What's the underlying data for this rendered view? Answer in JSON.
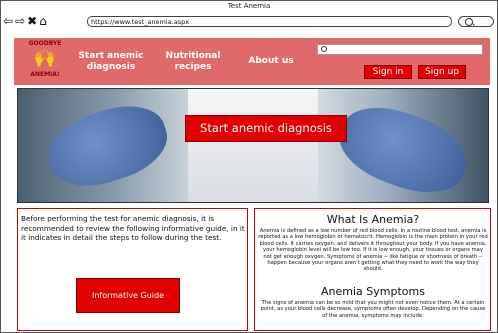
{
  "window": {
    "title": "Test Anemia"
  },
  "browser": {
    "url": "https://www.test_anemia.aspx",
    "nav_icons": [
      "back-arrow-icon",
      "forward-arrow-icon",
      "close-icon",
      "home-icon"
    ]
  },
  "header": {
    "logo": {
      "line1": "GOODBYE",
      "line2": "ANEMIA!"
    },
    "nav": [
      {
        "label": "Start anemic diagnosis"
      },
      {
        "label": "Nutritional recipes"
      },
      {
        "label": "About us"
      }
    ],
    "search": {
      "placeholder": ""
    },
    "sign_in_label": "Sign in",
    "sign_up_label": "Sign up",
    "accent": "#e06a6a",
    "button_color": "#e00000"
  },
  "hero": {
    "cta_label": "Start anemic  diagnosis"
  },
  "info_panel": {
    "text": "Before performing the test for anemic diagnosis, it is recommended to review the following informative guide, in it it indicates in detail the steps to follow during the test.",
    "button_label": "Informative Guide"
  },
  "anemia_panel": {
    "title": "What Is Anemia?",
    "body": "Anemia is defined as a low number of red blood cells. In a routine blood test, anemia is reported as a low hemoglobin or hematocrit. Hemoglobin is the main protein in your red blood cells. It carries oxygen, and delivers it throughout your body. If you have anemia, your hemoglobin level will be low too. If it is low enough, your tissues or organs may not get enough oxygen. Symptoms of anemia -- like fatigue or shortness of breath -- happen because your organs aren't getting what they need to work the way they should.",
    "symptoms_title": "Anemia Symptoms",
    "symptoms_body": "The signs of anemia can be so mild that you might not even notice them. At a certain point, as your blood cells decrease, symptoms often develop. Depending on the cause of the anemia, symptoms may include:"
  }
}
